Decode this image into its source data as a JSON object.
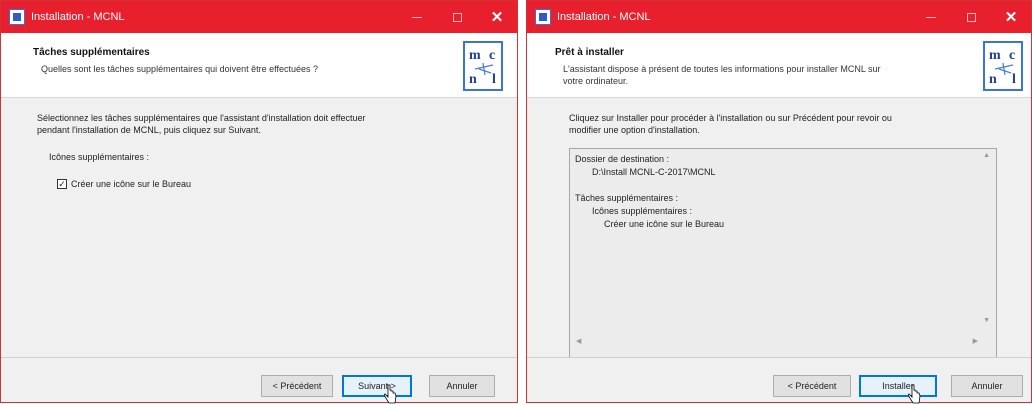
{
  "window_left": {
    "title": "Installation - MCNL",
    "controls": {
      "minimize": "—",
      "maximize": "☐",
      "close": "✕"
    },
    "header": {
      "title": "Tâches supplémentaires",
      "subtitle": "Quelles sont les tâches supplémentaires qui doivent être effectuées ?"
    },
    "logo_letters": [
      "m",
      "c",
      "n",
      "l"
    ],
    "body": {
      "intro_line1": "Sélectionnez les tâches supplémentaires que l'assistant d'installation doit effectuer",
      "intro_line2": "pendant l'installation de MCNL, puis cliquez sur Suivant.",
      "group_label": "Icônes supplémentaires :",
      "checkbox_label": "Créer une icône sur le Bureau",
      "checkbox_checked": true
    },
    "buttons": {
      "back": "< Précédent",
      "next": "Suivant >",
      "cancel": "Annuler"
    }
  },
  "window_right": {
    "title": "Installation - MCNL",
    "controls": {
      "minimize": "—",
      "maximize": "☐",
      "close": "✕"
    },
    "header": {
      "title": "Prêt à installer",
      "subtitle_line1": "L'assistant dispose à présent de toutes les informations pour installer MCNL sur",
      "subtitle_line2": "votre ordinateur."
    },
    "logo_letters": [
      "m",
      "c",
      "n",
      "l"
    ],
    "body": {
      "intro_line1": "Cliquez sur Installer pour procéder à l'installation ou sur Précédent pour revoir ou",
      "intro_line2": "modifier une option d'installation.",
      "memo": {
        "dest_label": "Dossier de destination :",
        "dest_path": "D:\\Install MCNL-C-2017\\MCNL",
        "tasks_label": "Tâches supplémentaires :",
        "icons_label": "Icônes supplémentaires :",
        "icon_task": "Créer une icône sur le Bureau"
      }
    },
    "buttons": {
      "back": "< Précédent",
      "install": "Installer",
      "cancel": "Annuler"
    }
  },
  "colors": {
    "titlebar": "#e8202d",
    "logo_border": "#3b73d9",
    "default_button": "#0078d7"
  }
}
